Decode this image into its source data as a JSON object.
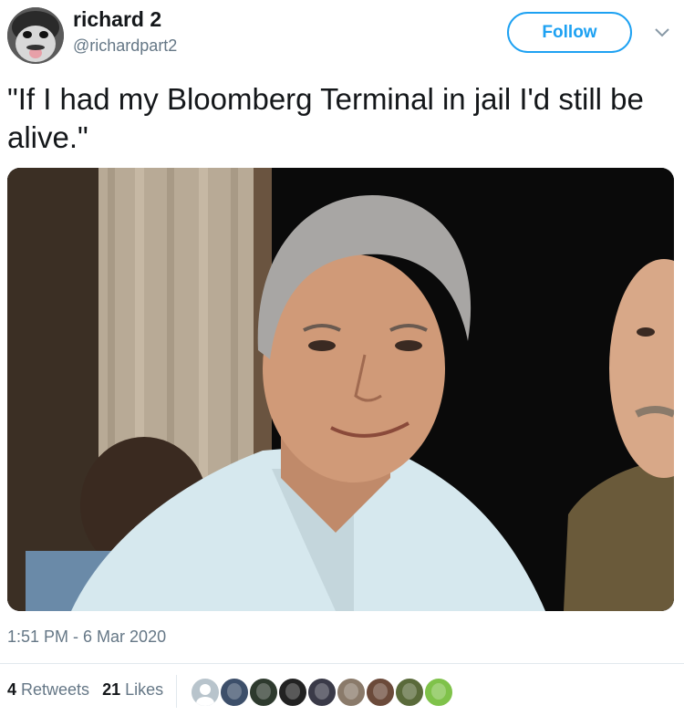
{
  "author": {
    "display_name": "richard 2",
    "handle": "@richardpart2"
  },
  "follow_label": "Follow",
  "tweet": {
    "text": "\"If I had my Bloomberg Terminal in jail I'd still be alive.\"",
    "timestamp": "1:51 PM - 6 Mar 2020"
  },
  "stats": {
    "retweets_count": "4",
    "retweets_label": "Retweets",
    "likes_count": "21",
    "likes_label": "Likes"
  },
  "likers": [
    {
      "color": "#b8c4cc",
      "icon": "default-avatar"
    },
    {
      "color": "#3d4f6a",
      "icon": "avatar"
    },
    {
      "color": "#2e3a2e",
      "icon": "avatar"
    },
    {
      "color": "#222222",
      "icon": "avatar"
    },
    {
      "color": "#3a3a48",
      "icon": "avatar"
    },
    {
      "color": "#8a7a6a",
      "icon": "avatar"
    },
    {
      "color": "#6b4a3a",
      "icon": "avatar"
    },
    {
      "color": "#5a6a3a",
      "icon": "avatar"
    },
    {
      "color": "#7fc24a",
      "icon": "pepe-avatar"
    }
  ],
  "colors": {
    "accent": "#1da1f2",
    "secondary_text": "#657786",
    "primary_text": "#14171a"
  }
}
